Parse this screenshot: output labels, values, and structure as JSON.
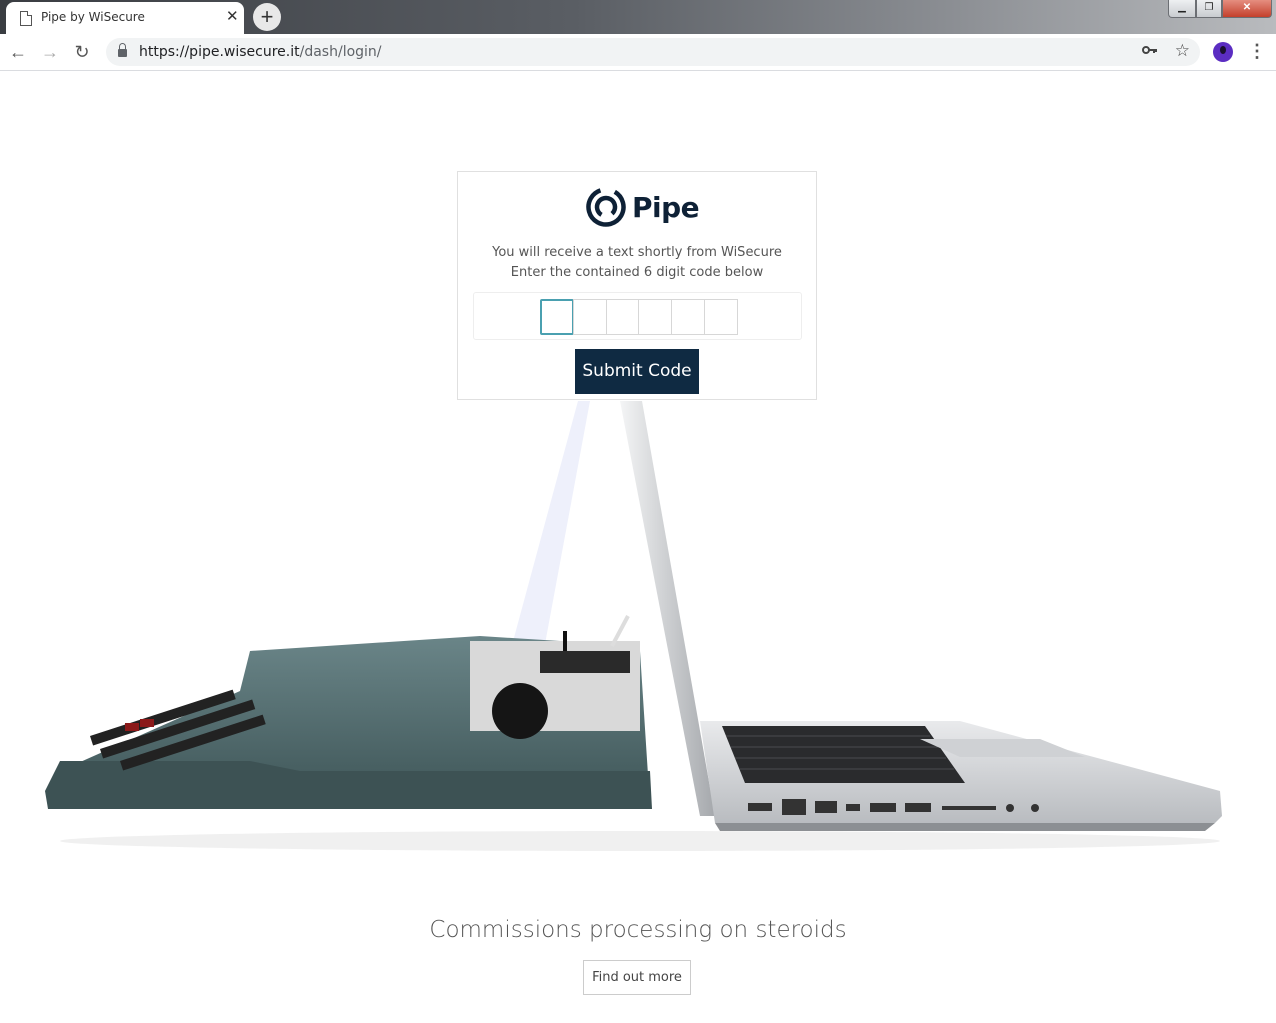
{
  "browser": {
    "tab_title": "Pipe by WiSecure",
    "tab_close": "✕",
    "new_tab": "+",
    "url_host": "https://pipe.wisecure.it",
    "url_path": "/dash/login/",
    "window_controls": {
      "minimize": "▁",
      "maximize": "❐",
      "close": "✕"
    },
    "nav": {
      "back": "←",
      "forward": "→",
      "reload": "↻"
    },
    "icons": {
      "key": "key-icon",
      "star": "star-icon",
      "menu": "⋮"
    }
  },
  "login": {
    "brand": "Pipe",
    "message_line1": "You will receive a text shortly from WiSecure",
    "message_line2": "Enter the contained 6 digit code below",
    "digits": [
      "",
      "",
      "",
      "",
      "",
      ""
    ],
    "submit_label": "Submit Code"
  },
  "hero": {
    "tagline": "Commissions processing on steroids",
    "cta_label": "Find out more"
  }
}
